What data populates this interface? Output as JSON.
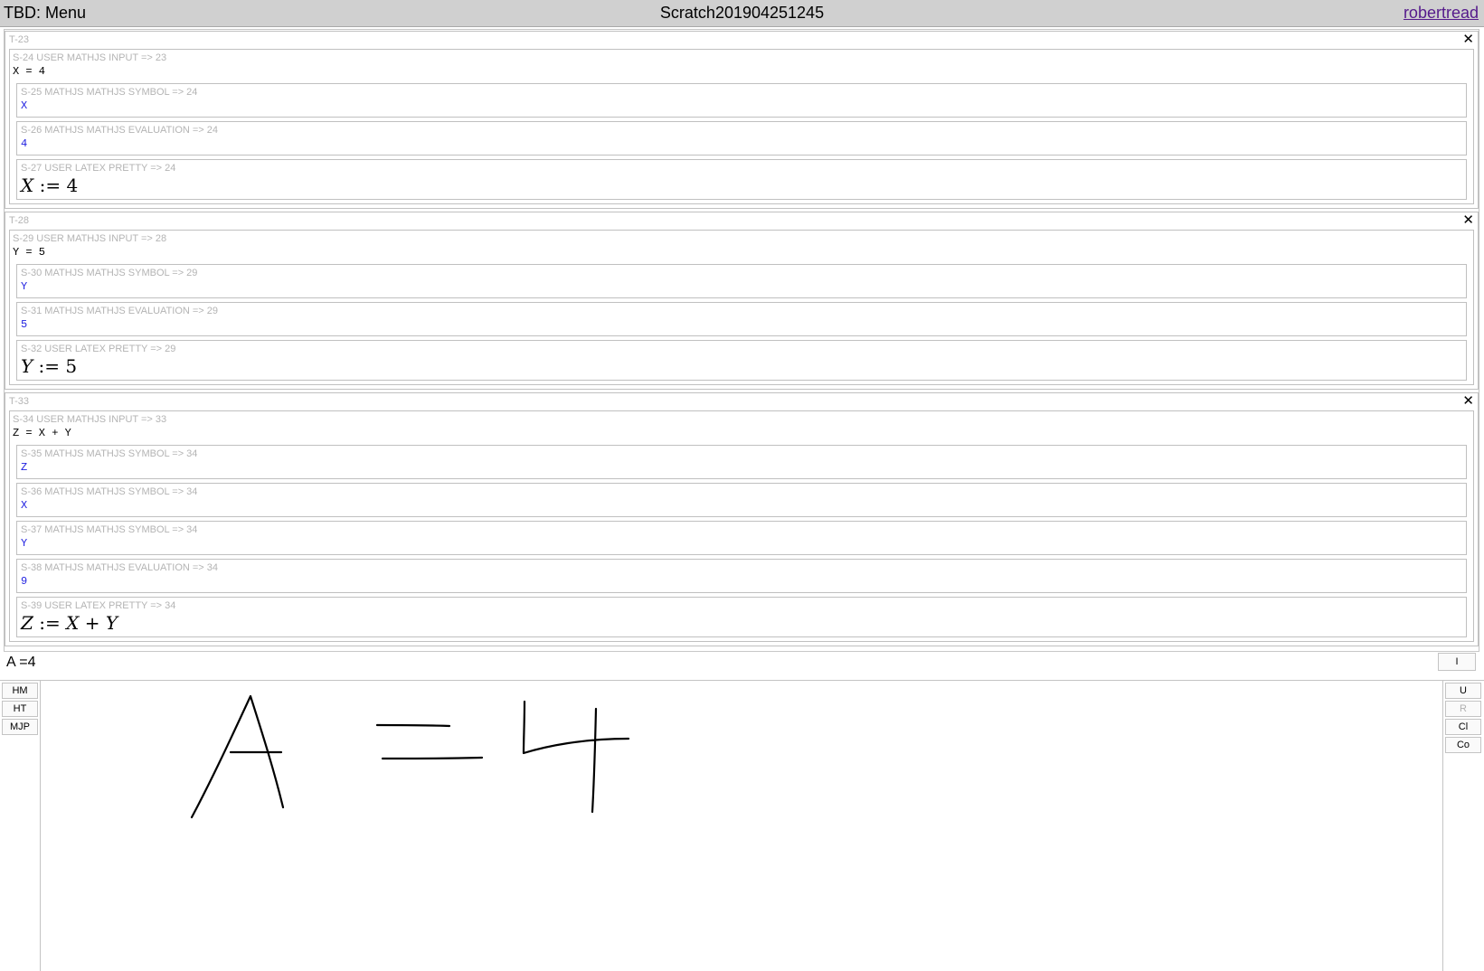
{
  "header": {
    "menu_label": "TBD: Menu",
    "notebook_title": "Scratch201904251245",
    "username": "robertread"
  },
  "thoughts": [
    {
      "label": "T-23",
      "input_label": "S-24 USER MATHJS INPUT => 23",
      "input_value": "X = 4",
      "styles": [
        {
          "label": "S-25 MATHJS MATHJS SYMBOL => 24",
          "value": "X"
        },
        {
          "label": "S-26 MATHJS MATHJS EVALUATION => 24",
          "value": "4"
        }
      ],
      "latex_label": "S-27 USER LATEX PRETTY => 24",
      "latex_value": "X := 4"
    },
    {
      "label": "T-28",
      "input_label": "S-29 USER MATHJS INPUT => 28",
      "input_value": "Y = 5",
      "styles": [
        {
          "label": "S-30 MATHJS MATHJS SYMBOL => 29",
          "value": "Y"
        },
        {
          "label": "S-31 MATHJS MATHJS EVALUATION => 29",
          "value": "5"
        }
      ],
      "latex_label": "S-32 USER LATEX PRETTY => 29",
      "latex_value": "Y := 5"
    },
    {
      "label": "T-33",
      "input_label": "S-34 USER MATHJS INPUT => 33",
      "input_value": "Z = X + Y",
      "styles": [
        {
          "label": "S-35 MATHJS MATHJS SYMBOL => 34",
          "value": "Z"
        },
        {
          "label": "S-36 MATHJS MATHJS SYMBOL => 34",
          "value": "X"
        },
        {
          "label": "S-37 MATHJS MATHJS SYMBOL => 34",
          "value": "Y"
        },
        {
          "label": "S-38 MATHJS MATHJS EVALUATION => 34",
          "value": "9"
        }
      ],
      "latex_label": "S-39 USER LATEX PRETTY => 34",
      "latex_value": "Z := X + Y"
    }
  ],
  "input_bar": {
    "value": "A =4",
    "insert_button": "I"
  },
  "left_tools": [
    "HM",
    "HT",
    "MJP"
  ],
  "right_tools": [
    {
      "label": "U",
      "enabled": true
    },
    {
      "label": "R",
      "enabled": false
    },
    {
      "label": "Cl",
      "enabled": true
    },
    {
      "label": "Co",
      "enabled": true
    }
  ],
  "handwriting": {
    "recognized_text": "A = 4",
    "stroke_color": "#000000"
  },
  "icons": {
    "close": "close-icon"
  },
  "colors": {
    "header_bg": "#d0d0d0",
    "label_gray": "#b4b4b4",
    "value_blue": "#1f1fe0",
    "link_purple": "#551a8b"
  }
}
